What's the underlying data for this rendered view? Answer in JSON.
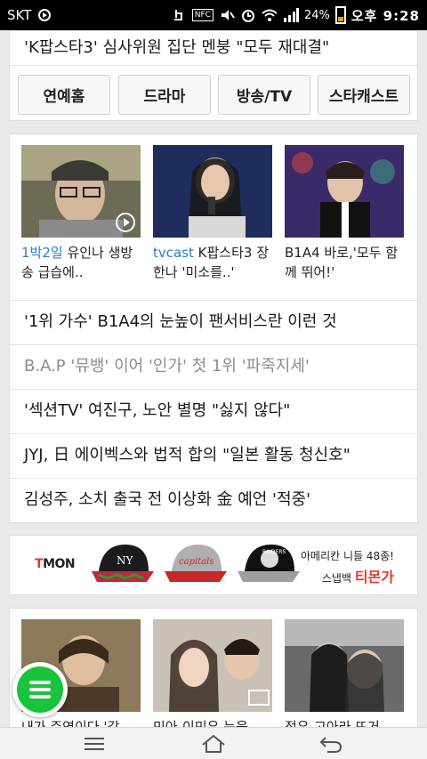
{
  "status_bar": {
    "carrier": "SKT",
    "nfc_label": "NFC",
    "battery": "24%",
    "time": "오후 9:28"
  },
  "top_card": {
    "headline": "'K팝스타3' 심사위원 집단 멘붕 \"모두 재대결\"",
    "categories": [
      "연예홈",
      "드라마",
      "방송/TV",
      "스타캐스트"
    ]
  },
  "featured": [
    {
      "tag": "1박2일",
      "text": " 유인나 생방송 급습에..",
      "has_video": true
    },
    {
      "tag": "tvcast",
      "text": " K팝스타3 장한나 '미소를..'",
      "has_video": false
    },
    {
      "tag": "",
      "text": "B1A4 바로,'모두 함께 뛰어!'",
      "has_video": false
    }
  ],
  "news": [
    {
      "title": "'1위 가수' B1A4의 눈높이 팬서비스란 이런 것",
      "read": false
    },
    {
      "title": "B.A.P '뮤뱅' 이어 '인가' 첫 1위 '파죽지세'",
      "read": true
    },
    {
      "title": "'섹션TV' 여진구, 노안 별명 \"싫지 않다\"",
      "read": false
    },
    {
      "title": "JYJ, 日 에이벡스와 법적 합의 \"일본 활동 청신호\"",
      "read": false
    },
    {
      "title": "김성주, 소치 출국 전 이상화 金 예언 '적중'",
      "read": false
    }
  ],
  "ad": {
    "logo_prefix": "T",
    "logo_rest": "MON",
    "line1": "아메리칸 니들 48종!",
    "line2_prefix": "스냅백 ",
    "brand": "티몬가"
  },
  "bottom_cards": [
    {
      "text": "내가 주연이다 '갑"
    },
    {
      "text": "민아-이민우 눈웃"
    },
    {
      "text": "정우-고아라 뜨거"
    }
  ],
  "colors": {
    "accent_blue": "#2a7cc7",
    "fab_green": "#19c33c",
    "ad_red": "#e63a2a"
  }
}
